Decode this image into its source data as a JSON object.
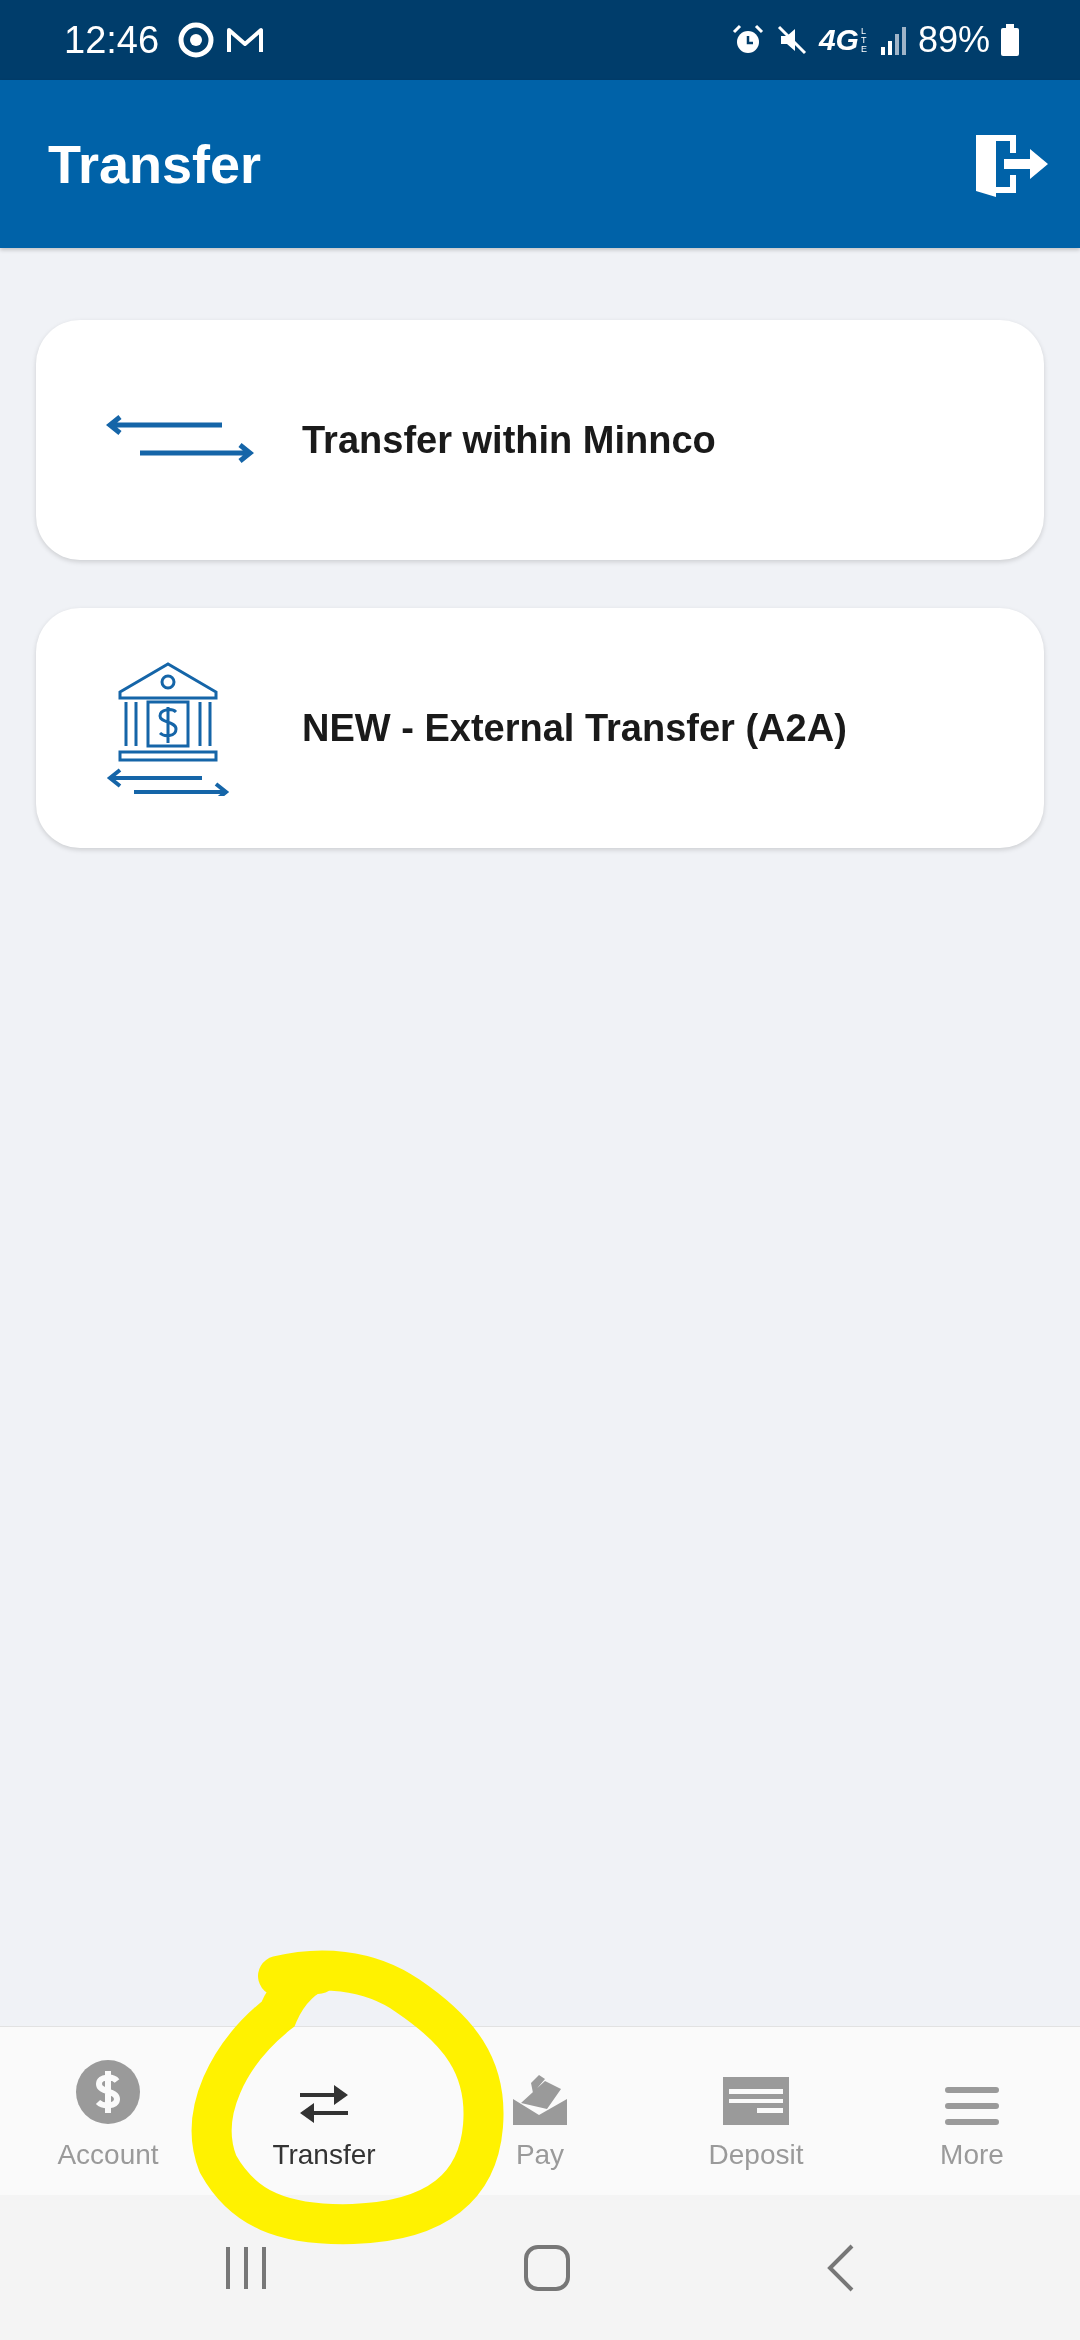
{
  "status_bar": {
    "time": "12:46",
    "network": "4G",
    "network_sub": "LTE",
    "battery": "89%"
  },
  "header": {
    "title": "Transfer"
  },
  "cards": [
    {
      "kind": "arrows",
      "label": "Transfer within Minnco"
    },
    {
      "kind": "bank",
      "label": "NEW - External Transfer (A2A)"
    }
  ],
  "nav": [
    {
      "kind": "dollar",
      "label": "Account",
      "selected": false
    },
    {
      "kind": "transfer",
      "label": "Transfer",
      "selected": true
    },
    {
      "kind": "pay",
      "label": "Pay",
      "selected": false
    },
    {
      "kind": "deposit",
      "label": "Deposit",
      "selected": false
    },
    {
      "kind": "more",
      "label": "More",
      "selected": false
    }
  ]
}
